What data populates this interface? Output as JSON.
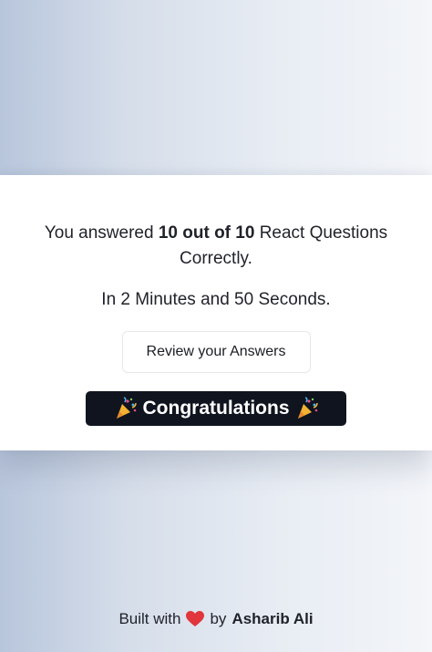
{
  "result": {
    "answered_prefix": "You answered",
    "score": "10 out of 10",
    "answered_suffix": "React Questions Correctly.",
    "time_text": "In 2 Minutes and 50 Seconds.",
    "review_button_label": "Review your Answers",
    "congrats_label": "Congratulations",
    "congrats_icon": "party-popper-icon"
  },
  "footer": {
    "built_with": "Built with",
    "heart_icon": "heart-icon",
    "by": "by",
    "author": "Asharib Ali"
  },
  "colors": {
    "banner_bg": "#0f141f",
    "heart": "#e0363c"
  }
}
